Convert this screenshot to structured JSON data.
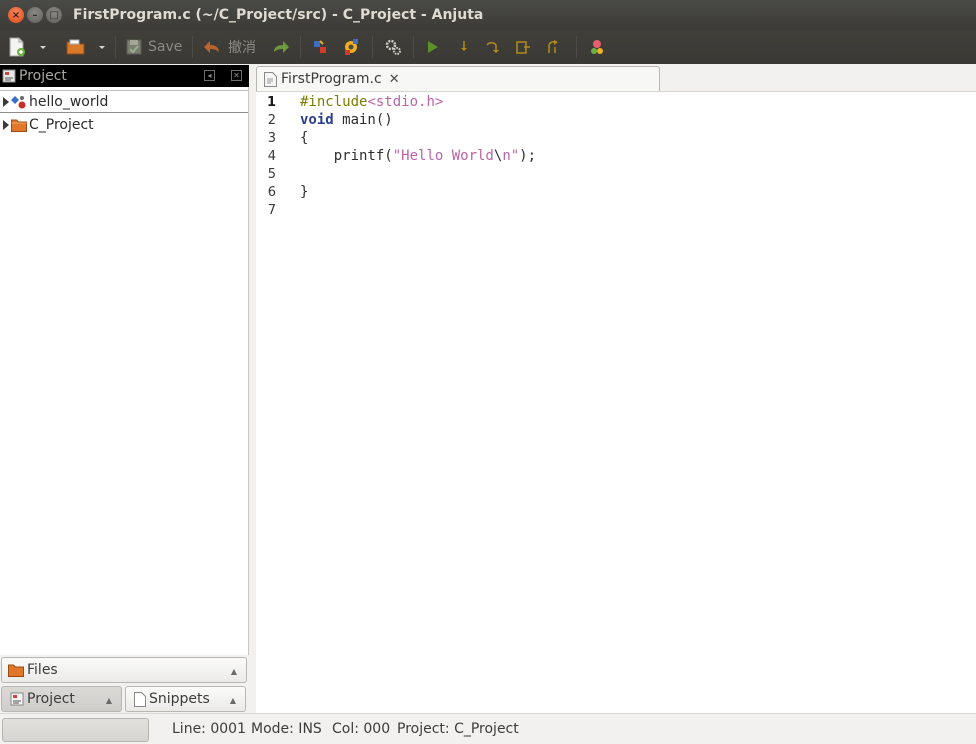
{
  "window": {
    "title": "FirstProgram.c (~/C_Project/src) - C_Project - Anjuta",
    "close_glyph": "×",
    "min_glyph": "–",
    "max_glyph": "□"
  },
  "toolbar": {
    "save_label": "Save",
    "undo_label": "撤消"
  },
  "left_panel": {
    "header_label": "Project",
    "tree": [
      {
        "label": "hello_world",
        "icon": "target-icon",
        "selected": true
      },
      {
        "label": "C_Project",
        "icon": "folder-icon",
        "selected": false
      }
    ],
    "bottom_tabs": {
      "files": "Files",
      "project": "Project",
      "snippets": "Snippets"
    }
  },
  "editor": {
    "tab_label": "FirstProgram.c",
    "tab_close_glyph": "✕",
    "current_line": 1,
    "line_numbers": [
      "1",
      "2",
      "3",
      "4",
      "5",
      "6",
      "7"
    ],
    "lines": {
      "l1_directive": "#include",
      "l1_header": "<stdio.h>",
      "l2_keyword": "void",
      "l2_rest": " main()",
      "l3": "{",
      "l4_func": "    printf(",
      "l4_str1": "\"Hello World",
      "l4_esc": "\\",
      "l4_str2": "n\"",
      "l4_end": ");",
      "l5": "",
      "l6": "}",
      "l7": ""
    }
  },
  "statusbar": {
    "line": "Line: 0001",
    "mode": "Mode: INS",
    "col": "Col: 000",
    "project": "Project: C_Project"
  },
  "colors": {
    "titlebar": "#3c3b37",
    "close_button": "#df4a16",
    "keyword": "#2c3f8f",
    "string": "#b865a6",
    "preprocessor": "#7e7c00"
  }
}
